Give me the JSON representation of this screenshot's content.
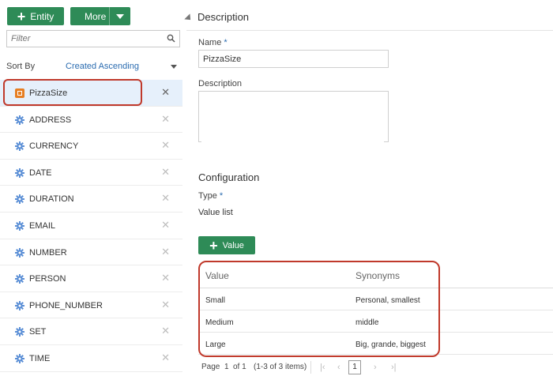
{
  "toolbar": {
    "entity_label": "Entity",
    "more_label": "More"
  },
  "filter": {
    "placeholder": "Filter"
  },
  "sort": {
    "label": "Sort By",
    "value": "Created Ascending"
  },
  "entities": [
    {
      "name": "PizzaSize",
      "type": "custom",
      "selected": true
    },
    {
      "name": "ADDRESS",
      "type": "system"
    },
    {
      "name": "CURRENCY",
      "type": "system"
    },
    {
      "name": "DATE",
      "type": "system"
    },
    {
      "name": "DURATION",
      "type": "system"
    },
    {
      "name": "EMAIL",
      "type": "system"
    },
    {
      "name": "NUMBER",
      "type": "system"
    },
    {
      "name": "PERSON",
      "type": "system"
    },
    {
      "name": "PHONE_NUMBER",
      "type": "system"
    },
    {
      "name": "SET",
      "type": "system"
    },
    {
      "name": "TIME",
      "type": "system"
    }
  ],
  "description_section": {
    "title": "Description",
    "name_label": "Name",
    "name_value": "PizzaSize",
    "description_label": "Description",
    "description_value": ""
  },
  "configuration": {
    "title": "Configuration",
    "type_label": "Type",
    "type_value": "Value list",
    "add_value_label": "Value"
  },
  "values_table": {
    "headers": [
      "Value",
      "Synonyms"
    ],
    "rows": [
      {
        "value": "Small",
        "synonyms": "Personal, smallest"
      },
      {
        "value": "Medium",
        "synonyms": "middle"
      },
      {
        "value": "Large",
        "synonyms": "Big, grande, biggest"
      }
    ]
  },
  "pagination": {
    "page_label": "Page",
    "current_page": "1",
    "of_label": "of 1",
    "range_text": "(1-3 of 3 items)",
    "page_button": "1"
  },
  "required_marker": "*",
  "colors": {
    "accent_green": "#2e8b57",
    "highlight_red": "#c0392b",
    "link_blue": "#2b6cb0",
    "entity_orange": "#e67e22"
  }
}
